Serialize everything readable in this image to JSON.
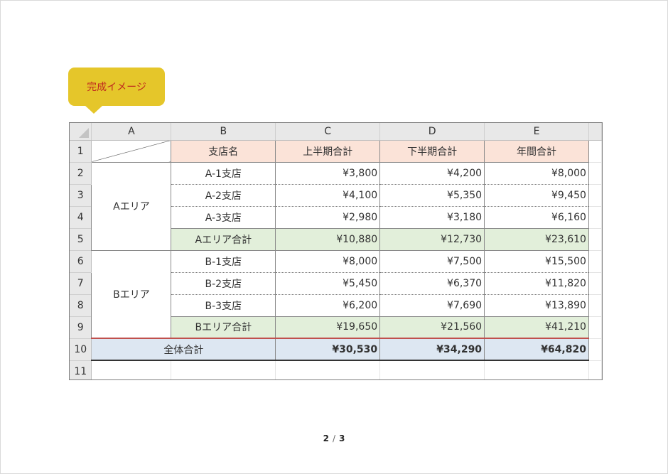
{
  "callout": {
    "label": "完成イメージ",
    "color": "#e5c62a",
    "text_color": "#c0281e"
  },
  "sheet": {
    "columns": [
      "A",
      "B",
      "C",
      "D",
      "E"
    ],
    "row_numbers": [
      "1",
      "2",
      "3",
      "4",
      "5",
      "6",
      "7",
      "8",
      "9",
      "10",
      "11"
    ],
    "headers": {
      "branch": "支店名",
      "first_half": "上半期合計",
      "second_half": "下半期合計",
      "annual": "年間合計"
    },
    "areas": [
      {
        "name": "Aエリア",
        "rows": [
          {
            "branch": "A-1支店",
            "first_half": "¥3,800",
            "second_half": "¥4,200",
            "annual": "¥8,000"
          },
          {
            "branch": "A-2支店",
            "first_half": "¥4,100",
            "second_half": "¥5,350",
            "annual": "¥9,450"
          },
          {
            "branch": "A-3支店",
            "first_half": "¥2,980",
            "second_half": "¥3,180",
            "annual": "¥6,160"
          }
        ],
        "subtotal": {
          "label": "Aエリア合計",
          "first_half": "¥10,880",
          "second_half": "¥12,730",
          "annual": "¥23,610"
        }
      },
      {
        "name": "Bエリア",
        "rows": [
          {
            "branch": "B-1支店",
            "first_half": "¥8,000",
            "second_half": "¥7,500",
            "annual": "¥15,500"
          },
          {
            "branch": "B-2支店",
            "first_half": "¥5,450",
            "second_half": "¥6,370",
            "annual": "¥11,820"
          },
          {
            "branch": "B-3支店",
            "first_half": "¥6,200",
            "second_half": "¥7,690",
            "annual": "¥13,890"
          }
        ],
        "subtotal": {
          "label": "Bエリア合計",
          "first_half": "¥19,650",
          "second_half": "¥21,560",
          "annual": "¥41,210"
        }
      }
    ],
    "grand_total": {
      "label": "全体合計",
      "first_half": "¥30,530",
      "second_half": "¥34,290",
      "annual": "¥64,820"
    },
    "colors": {
      "header_fill": "#fbe3d8",
      "subtotal_fill": "#e2efda",
      "total_fill": "#dde7f2",
      "total_top_border": "#c0504d"
    }
  },
  "pager": {
    "current": "2",
    "separator": "/",
    "total": "3"
  }
}
